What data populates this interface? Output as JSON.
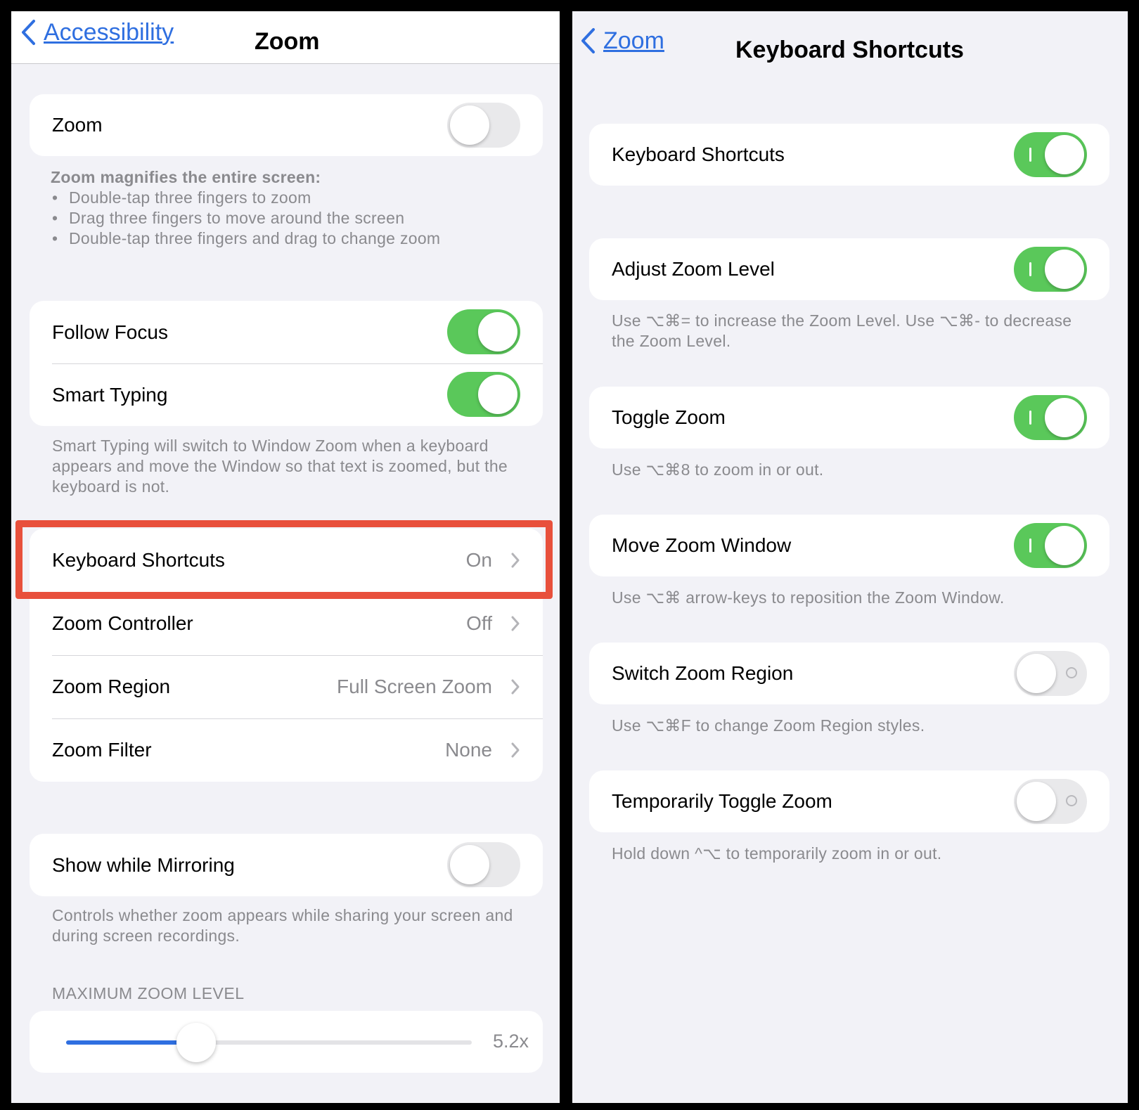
{
  "left": {
    "nav": {
      "back_label": "Accessibility",
      "title": "Zoom"
    },
    "zoom_row": {
      "label": "Zoom",
      "toggle": false
    },
    "zoom_info": {
      "heading": "Zoom magnifies the entire screen:",
      "bullets": [
        "Double-tap three fingers to zoom",
        "Drag three fingers to move around the screen",
        "Double-tap three fingers and drag to change zoom"
      ]
    },
    "follow_focus": {
      "label": "Follow Focus",
      "toggle": true
    },
    "smart_typing": {
      "label": "Smart Typing",
      "toggle": true
    },
    "smart_typing_footer": "Smart Typing will switch to Window Zoom when a keyboard appears and move the Window so that text is zoomed, but the keyboard is not.",
    "nav_rows": [
      {
        "label": "Keyboard Shortcuts",
        "value": "On"
      },
      {
        "label": "Zoom Controller",
        "value": "Off"
      },
      {
        "label": "Zoom Region",
        "value": "Full Screen Zoom"
      },
      {
        "label": "Zoom Filter",
        "value": "None"
      }
    ],
    "mirroring": {
      "label": "Show while Mirroring",
      "toggle": false
    },
    "mirroring_footer": "Controls whether zoom appears while sharing your screen and during screen recordings.",
    "max_zoom": {
      "header": "MAXIMUM ZOOM LEVEL",
      "value_label": "5.2x",
      "level_fraction": 0.32
    }
  },
  "right": {
    "nav": {
      "back_label": "Zoom",
      "title": "Keyboard Shortcuts"
    },
    "rows": [
      {
        "label": "Keyboard Shortcuts",
        "toggle": true,
        "footer": ""
      },
      {
        "label": "Adjust Zoom Level",
        "toggle": true,
        "footer": "Use ⌥⌘= to increase the Zoom Level. Use ⌥⌘- to decrease the Zoom Level."
      },
      {
        "label": "Toggle Zoom",
        "toggle": true,
        "footer": "Use ⌥⌘8 to zoom in or out."
      },
      {
        "label": "Move Zoom Window",
        "toggle": true,
        "footer": "Use ⌥⌘ arrow-keys to reposition the Zoom Window."
      },
      {
        "label": "Switch Zoom Region",
        "toggle": false,
        "footer": "Use ⌥⌘F to change Zoom Region styles."
      },
      {
        "label": "Temporarily Toggle Zoom",
        "toggle": false,
        "footer": "Hold down ^⌥ to temporarily zoom in or out."
      }
    ]
  },
  "colors": {
    "accent": "#2f6fe0",
    "toggle_on": "#5ac85a",
    "highlight": "#e8503c",
    "background": "#f2f2f7"
  }
}
